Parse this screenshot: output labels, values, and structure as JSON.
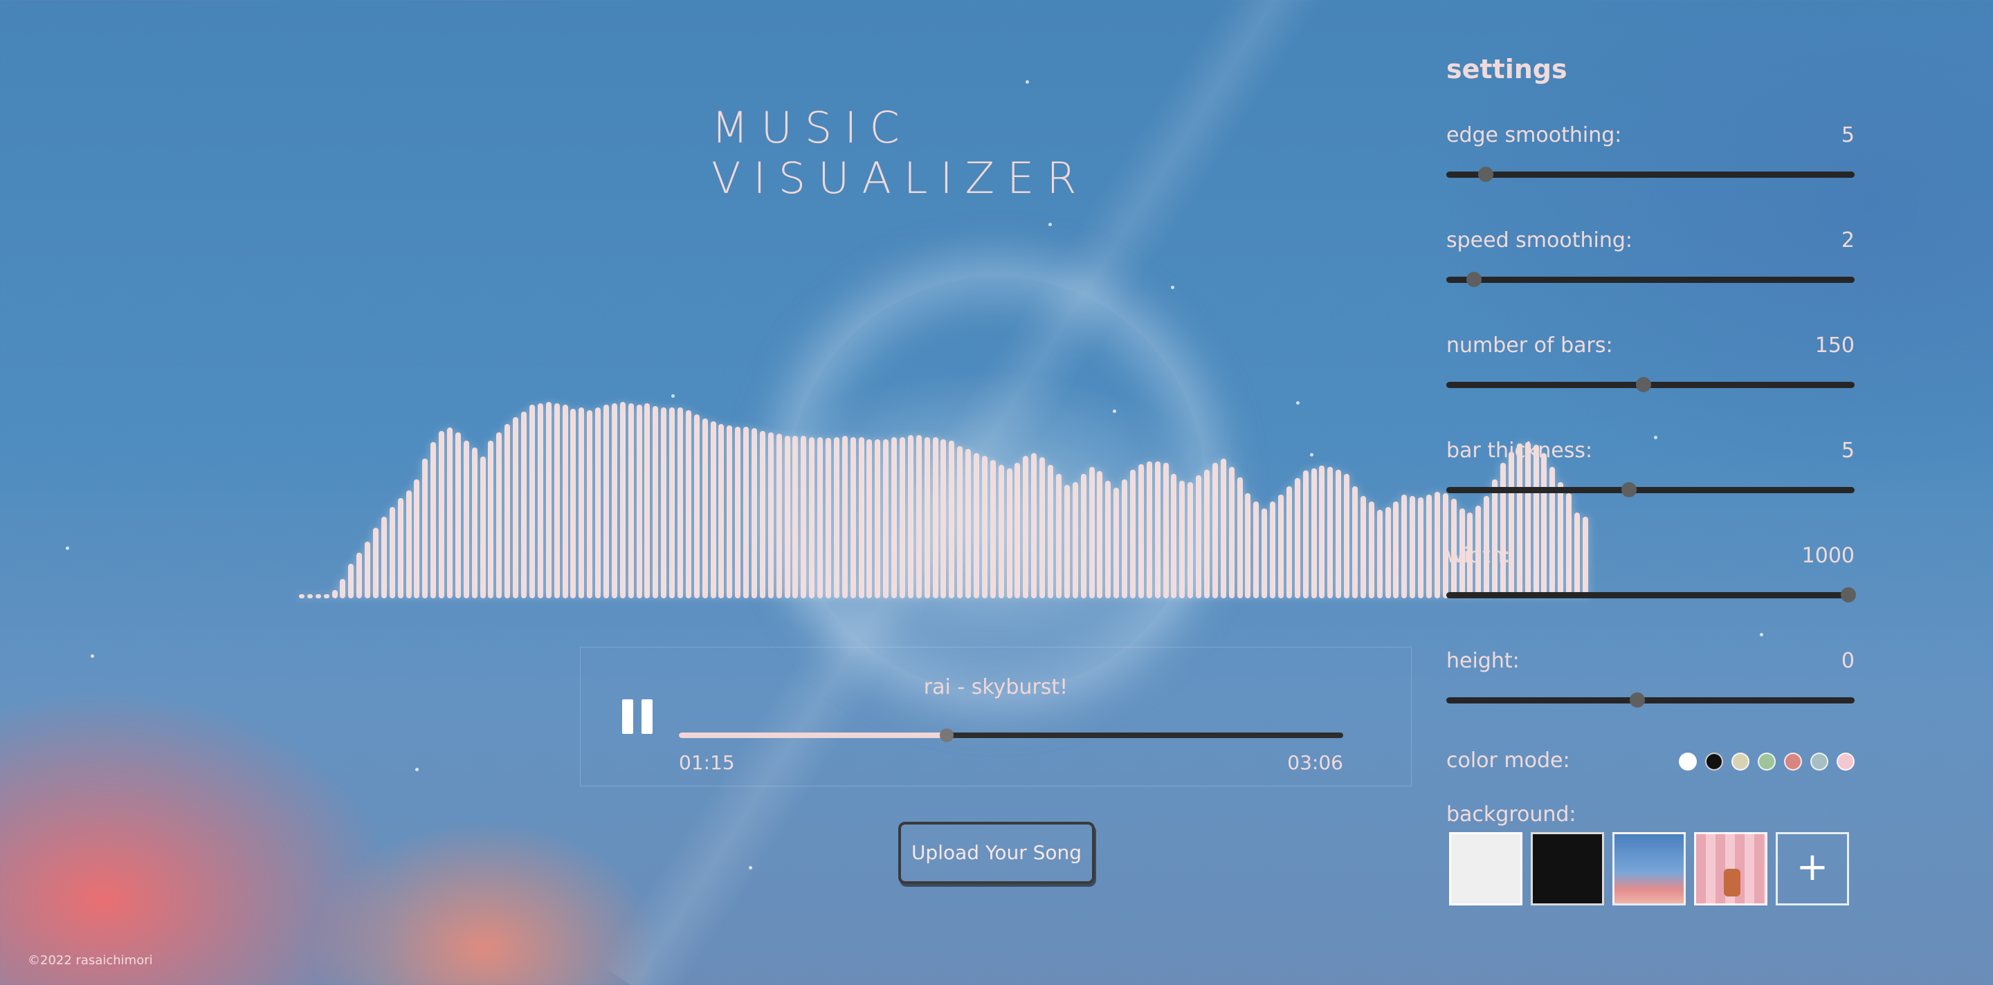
{
  "app": {
    "title": "MUSIC VISUALIZER",
    "copyright": "©2022 rasaichimori"
  },
  "player": {
    "song": "rai - skyburst!",
    "current_time": "01:15",
    "total_time": "03:06",
    "progress": 0.403,
    "state": "playing",
    "pause_icon": "pause-icon"
  },
  "upload": {
    "label": "Upload Your Song"
  },
  "visualizer": {
    "bar_color": "#f2dcdc",
    "bar_levels": [
      3,
      3,
      3,
      6,
      12,
      28,
      50,
      66,
      82,
      102,
      118,
      132,
      145,
      156,
      172,
      202,
      226,
      242,
      247,
      240,
      228,
      218,
      205,
      228,
      240,
      252,
      262,
      270,
      280,
      282,
      284,
      282,
      280,
      274,
      276,
      272,
      276,
      280,
      282,
      284,
      282,
      280,
      282,
      278,
      276,
      276,
      276,
      272,
      266,
      260,
      256,
      252,
      250,
      248,
      248,
      246,
      242,
      240,
      238,
      235,
      235,
      235,
      233,
      233,
      232,
      233,
      235,
      233,
      233,
      230,
      230,
      230,
      233,
      233,
      236,
      236,
      233,
      233,
      230,
      228,
      220,
      216,
      210,
      206,
      200,
      193,
      188,
      196,
      206,
      210,
      204,
      193,
      180,
      164,
      168,
      180,
      190,
      184,
      170,
      160,
      172,
      186,
      194,
      198,
      198,
      196,
      180,
      170,
      168,
      178,
      186,
      196,
      202,
      190,
      175,
      152,
      140,
      130,
      140,
      150,
      162,
      174,
      185,
      188,
      192,
      190,
      186,
      180,
      162,
      148,
      140,
      128,
      132,
      140,
      150,
      148,
      146,
      150,
      154,
      152,
      144,
      130,
      124,
      134,
      148,
      172,
      196,
      212,
      224,
      226,
      222,
      210,
      190,
      168,
      152,
      124,
      118
    ]
  },
  "settings": {
    "title": "settings",
    "items": [
      {
        "label": "edge smoothing:",
        "value": "5",
        "level": 0.097
      },
      {
        "label": "speed smoothing:",
        "value": "2",
        "level": 0.068
      },
      {
        "label": "number of bars:",
        "value": "150",
        "level": 0.483
      },
      {
        "label": "bar thickness:",
        "value": "5",
        "level": 0.447
      },
      {
        "label": "width:",
        "value": "1000",
        "level": 0.985
      },
      {
        "label": "height:",
        "value": "0",
        "level": 0.467
      }
    ],
    "color_mode": {
      "label": "color mode:",
      "swatches": [
        "#ffffff",
        "#111111",
        "#d8d2b4",
        "#9fc39a",
        "#d98682",
        "#a7bfc2",
        "#f3c7cf"
      ]
    },
    "background": {
      "label": "background:",
      "options": [
        "white",
        "black",
        "sky",
        "pink"
      ],
      "add_icon": "plus-icon",
      "add_symbol": "+"
    }
  }
}
